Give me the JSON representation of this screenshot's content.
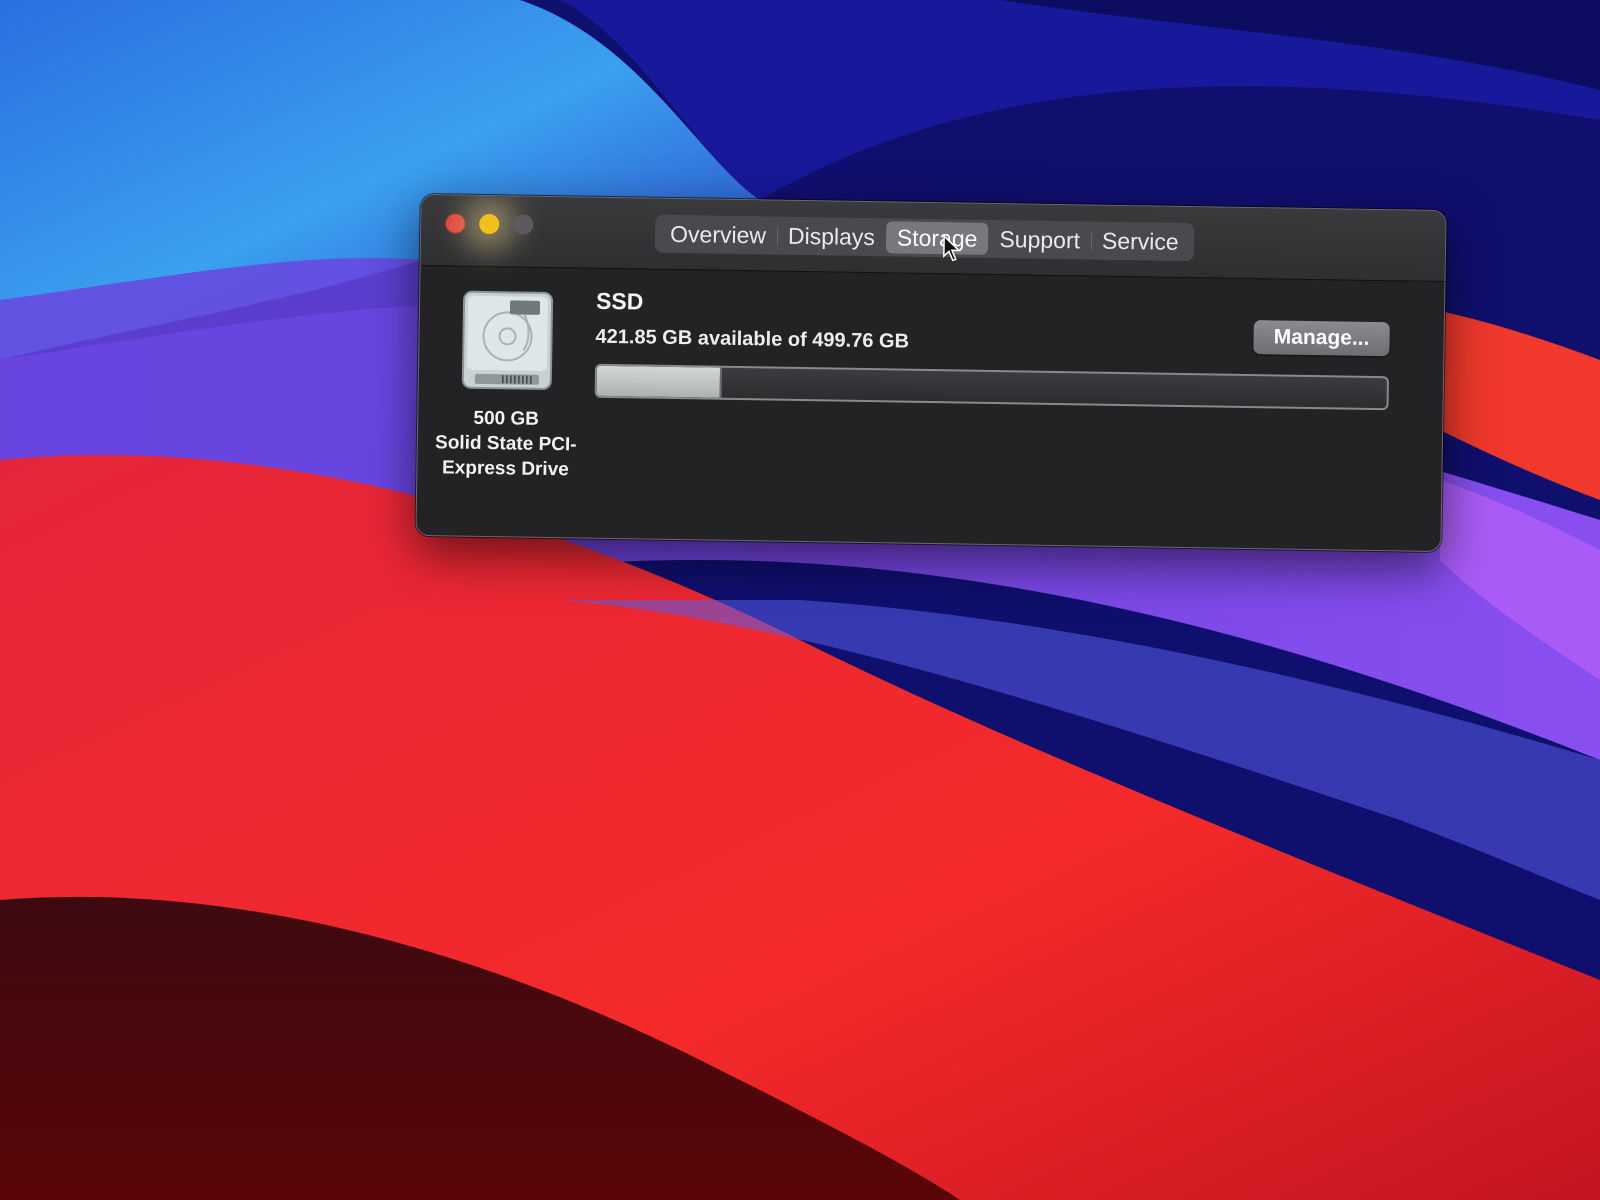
{
  "window": {
    "traffic_lights": [
      "close",
      "minimize",
      "zoom"
    ]
  },
  "tabs": [
    {
      "label": "Overview",
      "active": false
    },
    {
      "label": "Displays",
      "active": false
    },
    {
      "label": "Storage",
      "active": true
    },
    {
      "label": "Support",
      "active": false
    },
    {
      "label": "Service",
      "active": false
    }
  ],
  "disk": {
    "icon": "internal-drive-icon",
    "size": "500 GB",
    "type_line1": "Solid State PCI-",
    "type_line2": "Express Drive"
  },
  "volume": {
    "name": "SSD",
    "availability": "421.85 GB available of 499.76 GB",
    "used_fraction": 0.156
  },
  "buttons": {
    "manage_label": "Manage..."
  },
  "colors": {
    "close": "#e0443e",
    "minimize": "#f2c01b",
    "zoom_disabled": "#5b5b5f"
  }
}
